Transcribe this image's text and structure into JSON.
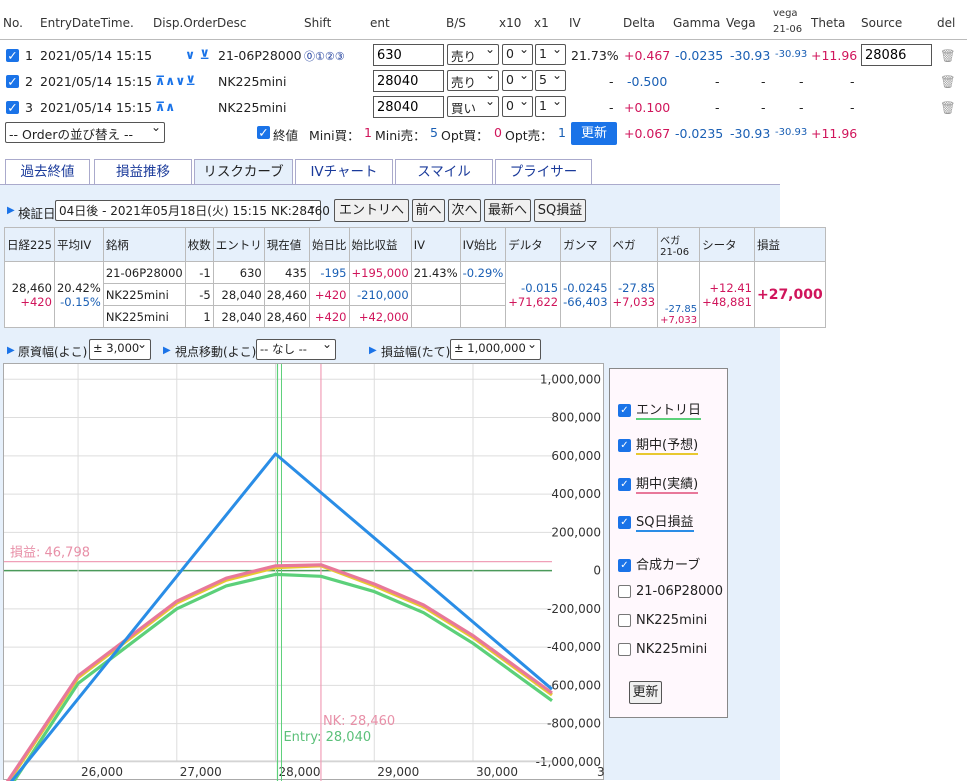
{
  "header": {
    "no": "No.",
    "entry": "EntryDateTime.",
    "disp": "Disp.Order",
    "desc": "Desc",
    "shift": "Shift",
    "ent": "ent",
    "bs": "B/S",
    "x10": "x10",
    "x1": "x1",
    "iv": "IV",
    "delta": "Delta",
    "gamma": "Gamma",
    "vega": "Vega",
    "vega2a": "vega",
    "vega2b": "21-06",
    "theta": "Theta",
    "source": "Source",
    "del": "del"
  },
  "rows": [
    {
      "no": "1",
      "dt": "2021/05/14 15:15",
      "arrows": "∨ ⊻",
      "desc": "21-06P28000",
      "ent": "630",
      "bs": "売り",
      "x10": "0",
      "x1": "1",
      "iv": "21.73%",
      "delta": "+0.467",
      "gamma": "-0.0235",
      "vega": "-30.93",
      "vega2": "-30.93",
      "theta": "+11.96",
      "source": "28086"
    },
    {
      "no": "2",
      "dt": "2021/05/14 15:15",
      "arrows": "⊼∧∨⊻",
      "desc": "NK225mini",
      "ent": "28040",
      "bs": "売り",
      "x10": "0",
      "x1": "5",
      "iv": "-",
      "delta": "-0.500",
      "gamma": "-",
      "vega": "-",
      "vega2": "-",
      "theta": "-",
      "source": ""
    },
    {
      "no": "3",
      "dt": "2021/05/14 15:15",
      "arrows": "⊼∧",
      "desc": "NK225mini",
      "ent": "28040",
      "bs": "買い",
      "x10": "0",
      "x1": "1",
      "iv": "-",
      "delta": "+0.100",
      "gamma": "-",
      "vega": "-",
      "vega2": "-",
      "theta": "-",
      "source": ""
    }
  ],
  "summary": {
    "order_select": "-- Orderの並び替え --",
    "close_label": "終値",
    "mini_buy_l": "Mini買：",
    "mini_buy": "1",
    "mini_sell_l": "Mini売：",
    "mini_sell": "5",
    "opt_buy_l": "Opt買：",
    "opt_buy": "0",
    "opt_sell_l": "Opt売：",
    "opt_sell": "1",
    "update": "更新",
    "delta": "+0.067",
    "gamma": "-0.0235",
    "vega": "-30.93",
    "vega2": "-30.93",
    "theta": "+11.96"
  },
  "tabs": [
    "過去終値",
    "損益推移",
    "リスクカーブ",
    "IVチャート",
    "スマイル",
    "プライサー"
  ],
  "verify": {
    "label": "検証日",
    "date": "04日後 - 2021年05月18日(火) 15:15 NK:28460",
    "entry_btn": "エントリへ",
    "prev_btn": "前へ",
    "next_btn": "次へ",
    "latest_btn": "最新へ",
    "sq_btn": "SQ損益"
  },
  "grid": {
    "headers": [
      "日経225",
      "平均IV",
      "銘柄",
      "枚数",
      "エントリ",
      "現在値",
      "始日比",
      "始比収益",
      "IV",
      "IV始比",
      "デルタ",
      "ガンマ",
      "ベガ",
      "ベガ 21-06",
      "シータ",
      "損益"
    ],
    "nk": "28,460",
    "nk_chg": "+420",
    "avg_iv": "20.42%",
    "avg_iv_chg": "-0.15%",
    "lines": [
      {
        "name": "21-06P28000",
        "qty": "-1",
        "entry": "630",
        "cur": "435",
        "chg": "-195",
        "pnl": "+195,000",
        "iv": "21.43%",
        "ivchg": "-0.29%"
      },
      {
        "name": "NK225mini",
        "qty": "-5",
        "entry": "28,040",
        "cur": "28,460",
        "chg": "+420",
        "pnl": "-210,000",
        "iv": "",
        "ivchg": ""
      },
      {
        "name": "NK225mini",
        "qty": "1",
        "entry": "28,040",
        "cur": "28,460",
        "chg": "+420",
        "pnl": "+42,000",
        "iv": "",
        "ivchg": ""
      }
    ],
    "delta": "-0.015",
    "delta2": "+71,622",
    "gamma": "-0.0245",
    "gamma2": "-66,403",
    "vega": "-27.85",
    "vega2": "+7,033",
    "vegab": "-27.85",
    "vegab2": "+7,033",
    "theta": "+12.41",
    "theta2": "+48,881",
    "pnl": "+27,000"
  },
  "controls": {
    "x_label": "原資幅(よこ)",
    "x_val": "± 3,000",
    "view_label": "視点移動(よこ)",
    "view_val": "-- なし --",
    "y_label": "損益幅(たて)",
    "y_val": "± 1,000,000"
  },
  "chart_data": {
    "type": "line",
    "xlim": [
      25250,
      30800
    ],
    "ylim": [
      -1100000,
      1080000
    ],
    "xticks": [
      26000,
      27000,
      28000,
      29000,
      30000
    ],
    "xtick_labels": [
      "26,000",
      "27,000",
      "28,000",
      "29,000",
      "30,000",
      "3"
    ],
    "yticks": [
      1000000,
      800000,
      600000,
      400000,
      200000,
      0,
      -200000,
      -400000,
      -600000,
      -800000,
      -1000000
    ],
    "ytick_labels": [
      "1,000,000",
      "800,000",
      "600,000",
      "400,000",
      "200,000",
      "0",
      "-200,000",
      "-400,000",
      "-600,000",
      "-800,000",
      "-1,000,000"
    ],
    "pnl_label": "損益: 46,798",
    "pnl_value": 46798,
    "nk_label": "NK: 28,460",
    "nk_value": 28460,
    "entry_label": "Entry: 28,040",
    "entry_value": 28040,
    "colors": {
      "sq": "#2a8de6",
      "entry": "#5cd07a",
      "mid_exp": "#e8c830",
      "mid_act": "#e8789a"
    },
    "series": [
      {
        "name": "SQ日損益",
        "x": [
          25250,
          28000,
          30800
        ],
        "y": [
          -1150000,
          610000,
          -620000
        ]
      },
      {
        "name": "エントリ日",
        "x": [
          25250,
          26000,
          27000,
          27500,
          28000,
          28460,
          29000,
          29500,
          30000,
          30800
        ],
        "y": [
          -1180000,
          -590000,
          -200000,
          -80000,
          -20000,
          -30000,
          -110000,
          -220000,
          -380000,
          -680000
        ]
      },
      {
        "name": "期中(予想)",
        "x": [
          25250,
          26000,
          27000,
          27500,
          28000,
          28460,
          29000,
          29500,
          30000,
          30800
        ],
        "y": [
          -1140000,
          -560000,
          -170000,
          -50000,
          15000,
          25000,
          -80000,
          -190000,
          -350000,
          -650000
        ]
      },
      {
        "name": "期中(実績)",
        "x": [
          25250,
          26000,
          27000,
          27500,
          28000,
          28460,
          29000,
          29500,
          30000,
          30800
        ],
        "y": [
          -1130000,
          -550000,
          -160000,
          -40000,
          25000,
          30000,
          -70000,
          -180000,
          -340000,
          -640000
        ]
      }
    ]
  },
  "legend": {
    "items": [
      {
        "label": "エントリ日",
        "checked": true,
        "color": "#5cd07a"
      },
      {
        "label": "期中(予想)",
        "checked": true,
        "color": "#e8c830"
      },
      {
        "label": "期中(実績)",
        "checked": true,
        "color": "#e8789a"
      },
      {
        "label": "SQ日損益",
        "checked": true,
        "color": "#2a8de6"
      },
      {
        "label": "合成カーブ",
        "checked": true,
        "color": ""
      },
      {
        "label": "21-06P28000",
        "checked": false,
        "color": ""
      },
      {
        "label": "NK225mini",
        "checked": false,
        "color": ""
      },
      {
        "label": "NK225mini",
        "checked": false,
        "color": ""
      }
    ],
    "update": "更新"
  }
}
